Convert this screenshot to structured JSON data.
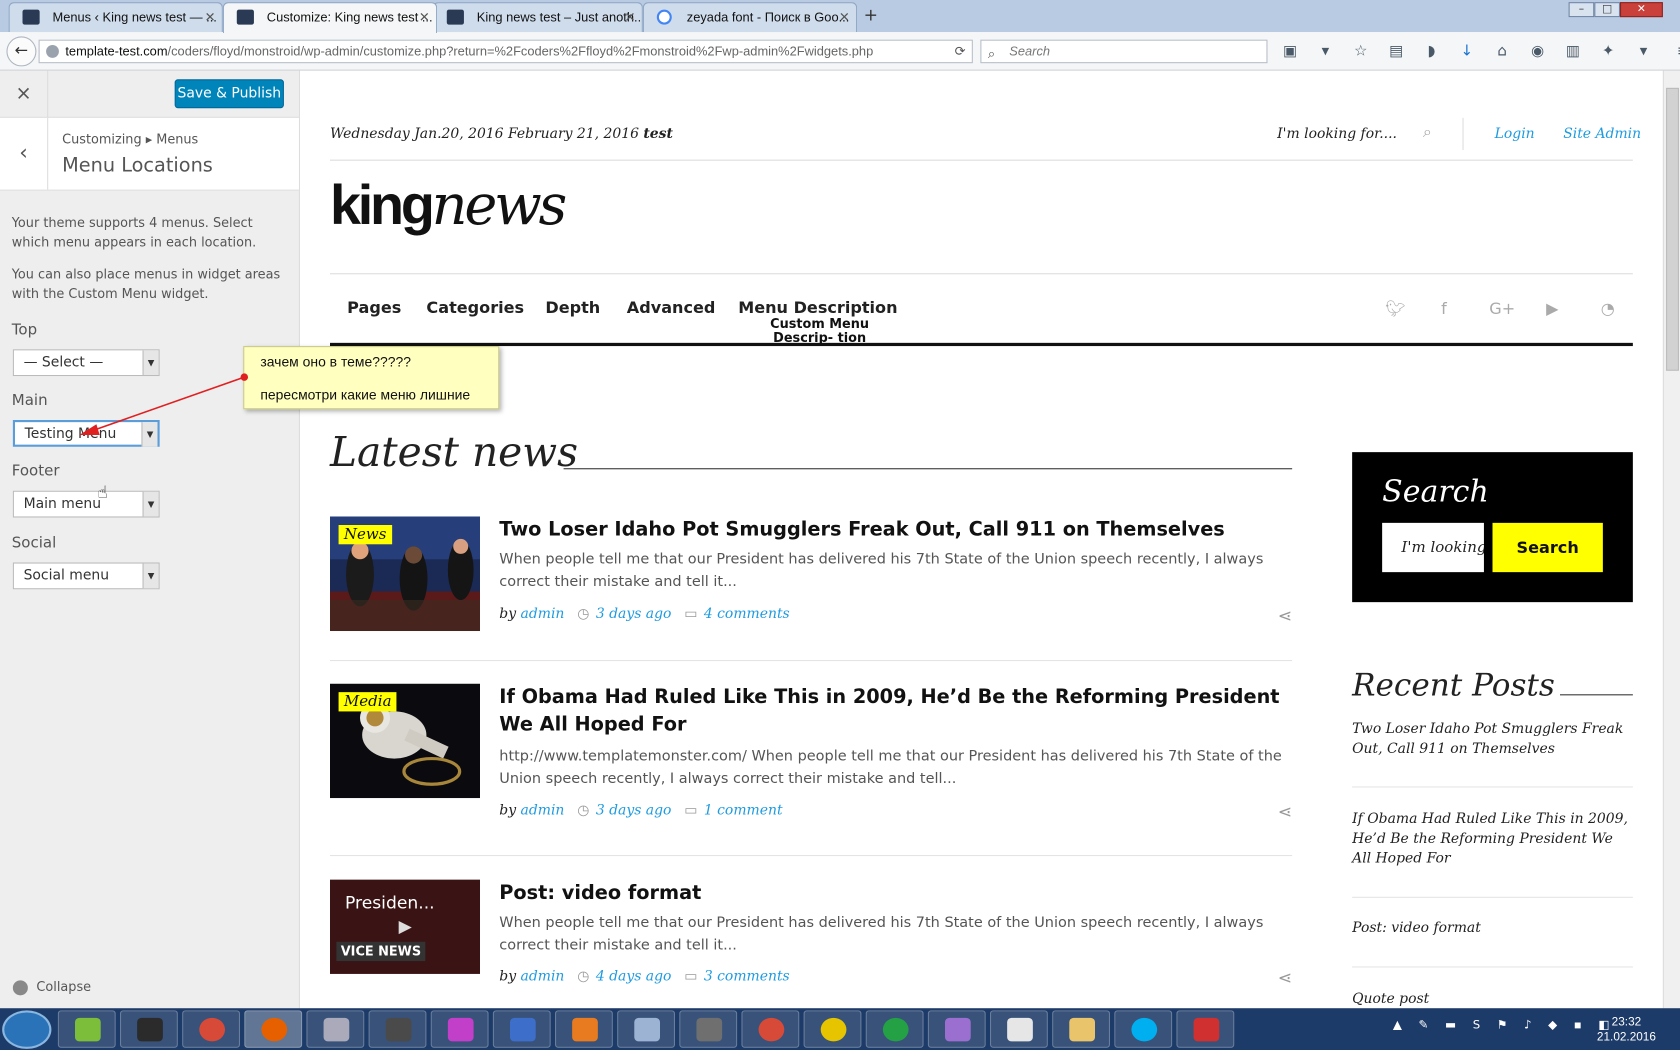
{
  "browser": {
    "tabs": [
      {
        "label": "Menus ‹ King news test — ..."
      },
      {
        "label": "Customize: King news test ..."
      },
      {
        "label": "King news test – Just anoth..."
      },
      {
        "label": "zeyada font - Поиск в Goo..."
      }
    ],
    "new_tab": "+",
    "url_host": "template-test.com",
    "url_path": "/coders/floyd/monstroid/wp-admin/customize.php?return=%2Fcoders%2Ffloyd%2Fmonstroid%2Fwp-admin%2Fwidgets.php",
    "search_placeholder": "Search"
  },
  "customizer": {
    "close": "×",
    "save_label": "Save & Publish",
    "back": "‹",
    "breadcrumb": "Customizing ▸ Menus",
    "title": "Menu Locations",
    "desc1": "Your theme supports 4 menus. Select which menu appears in each location.",
    "desc2": "You can also place menus in widget areas with the Custom Menu widget.",
    "locations": [
      {
        "label": "Top",
        "value": "— Select —"
      },
      {
        "label": "Main",
        "value": "Testing Menu"
      },
      {
        "label": "Footer",
        "value": "Main menu"
      },
      {
        "label": "Social",
        "value": "Social menu"
      }
    ],
    "collapse": "Collapse"
  },
  "note": {
    "line1": "зачем оно в теме?????",
    "line2": "пересмотри какие меню лишние"
  },
  "site": {
    "date": "Wednesday Jan.20, 2016 February 21, 2016",
    "date_bold": "test",
    "search_placeholder": "I'm looking for....",
    "login": "Login",
    "site_admin": "Site Admin",
    "logo_king": "king",
    "logo_news": "news",
    "menu": [
      "Pages",
      "Categories",
      "Depth",
      "Advanced",
      "Menu Description"
    ],
    "menu_desc": "Custom Menu Descrip- tion",
    "section_title": "Latest news",
    "posts": [
      {
        "badge": "News",
        "title": "Two Loser Idaho Pot Smugglers Freak Out, Call 911 on Themselves",
        "excerpt": "When people tell me that our President has delivered his 7th State of the Union speech recently, I always correct their mistake and tell it...",
        "by": "by",
        "author": "admin",
        "date": "3 days ago",
        "comments": "4 comments"
      },
      {
        "badge": "Media",
        "title": "If Obama Had Ruled Like This in 2009, He’d Be the Reforming President We All Hoped For",
        "excerpt": "http://www.templatemonster.com/ When people tell me that our President has delivered his 7th State of the Union speech recently, I always correct their mistake and tell...",
        "by": "by",
        "author": "admin",
        "date": "3 days ago",
        "comments": "1 comment"
      },
      {
        "badge": "",
        "video_title": "Presiden...",
        "video_brand": "VICE NEWS",
        "title": "Post: video format",
        "excerpt": "When people tell me that our President has delivered his 7th State of the Union speech recently, I always correct their mistake and tell it...",
        "by": "by",
        "author": "admin",
        "date": "4 days ago",
        "comments": "3 comments"
      }
    ],
    "sidebar": {
      "search_title": "Search",
      "search_value": "I'm looking for....",
      "search_button": "Search",
      "recent_title": "Recent Posts",
      "recent": [
        "Two Loser Idaho Pot Smugglers Freak Out, Call 911 on Themselves",
        "If Obama Had Ruled Like This in 2009, He’d Be the Reforming President We All Hoped For",
        "Post: video format",
        "Quote post"
      ]
    }
  },
  "taskbar": {
    "time": "23:32",
    "date": "21.02.2016"
  }
}
